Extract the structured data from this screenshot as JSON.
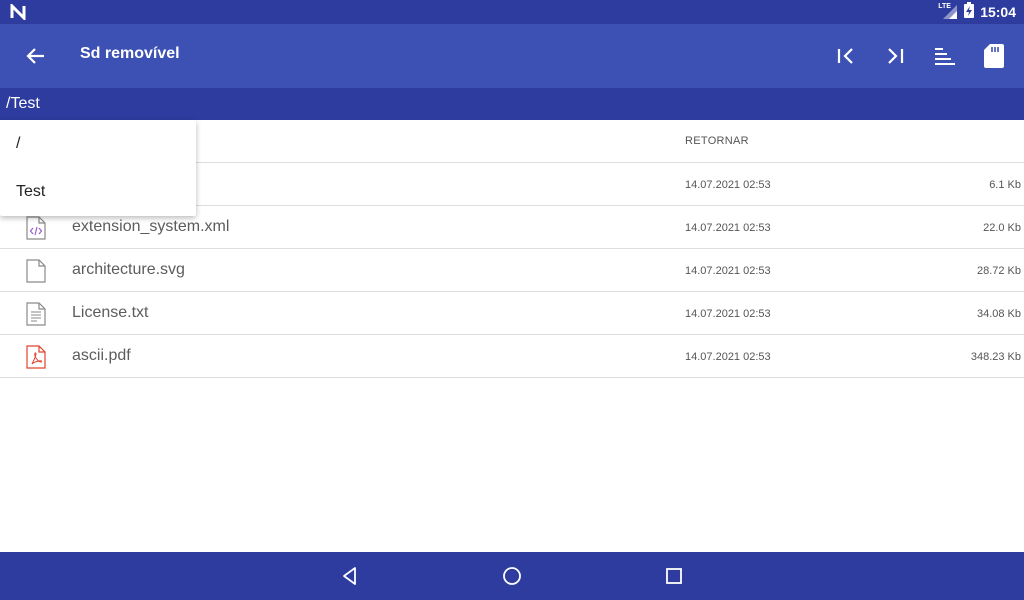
{
  "status_bar": {
    "time": "15:04",
    "network_label": "LTE",
    "icons": [
      "n-logo-icon",
      "lte-signal-icon",
      "battery-charging-icon"
    ]
  },
  "app_bar": {
    "title": "Sd removível",
    "actions": [
      "skip-first-icon",
      "skip-last-icon",
      "sort-icon",
      "sd-card-icon"
    ]
  },
  "path": "/Test",
  "dropdown": {
    "items": [
      "/",
      "Test"
    ]
  },
  "list": {
    "header_label": "RETORNAR",
    "files": [
      {
        "name": "",
        "date": "14.07.2021 02:53",
        "size": "6.1 Kb",
        "icon": "file-icon"
      },
      {
        "name": "extension_system.xml",
        "date": "14.07.2021 02:53",
        "size": "22.0 Kb",
        "icon": "xml-file-icon"
      },
      {
        "name": "architecture.svg",
        "date": "14.07.2021 02:53",
        "size": "28.72 Kb",
        "icon": "file-icon"
      },
      {
        "name": "License.txt",
        "date": "14.07.2021 02:53",
        "size": "34.08 Kb",
        "icon": "text-file-icon"
      },
      {
        "name": "ascii.pdf",
        "date": "14.07.2021 02:53",
        "size": "348.23 Kb",
        "icon": "pdf-file-icon"
      }
    ]
  },
  "colors": {
    "status_bar": "#2e3c9f",
    "app_bar": "#3d51b4",
    "path_bar": "#2e3c9f",
    "nav_bar": "#2e3c9f",
    "xml_icon": "#9c5fc9",
    "pdf_icon": "#e0442f"
  },
  "nav_bar": {
    "buttons": [
      "back-triangle-icon",
      "home-circle-icon",
      "recents-square-icon"
    ]
  }
}
